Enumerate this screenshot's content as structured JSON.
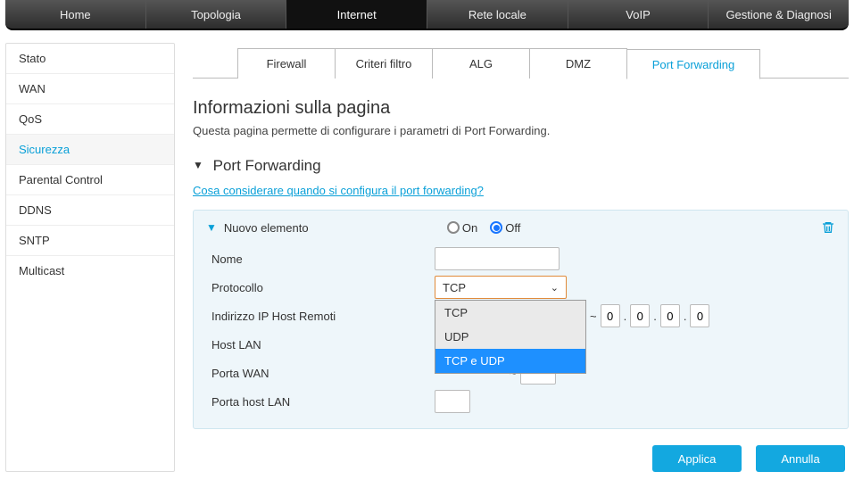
{
  "topnav": {
    "items": [
      "Home",
      "Topologia",
      "Internet",
      "Rete locale",
      "VoIP",
      "Gestione & Diagnosi"
    ],
    "active": 2
  },
  "sidebar": {
    "items": [
      "Stato",
      "WAN",
      "QoS",
      "Sicurezza",
      "Parental Control",
      "DDNS",
      "SNTP",
      "Multicast"
    ],
    "active": 3
  },
  "subtabs": {
    "items": [
      "Firewall",
      "Criteri filtro",
      "ALG",
      "DMZ",
      "Port Forwarding"
    ],
    "active": 4
  },
  "page_title": "Informazioni sulla pagina",
  "page_desc": "Questa pagina permette di configurare i parametri di Port Forwarding.",
  "section_title": "Port Forwarding",
  "help_link": "Cosa considerare quando si configura il port forwarding?",
  "panel": {
    "new_label": "Nuovo elemento",
    "radio": {
      "on": "On",
      "off": "Off",
      "checked": "off"
    },
    "fields": {
      "nome": {
        "label": "Nome",
        "value": ""
      },
      "protocollo": {
        "label": "Protocollo",
        "selected": "TCP",
        "options": [
          "TCP",
          "UDP",
          "TCP e UDP"
        ],
        "highlighted": 2
      },
      "ip_remoti": {
        "label": "Indirizzo IP Host Remoti",
        "oct2": [
          "0",
          "0",
          "0",
          "0"
        ]
      },
      "host_lan": {
        "label": "Host LAN"
      },
      "porta_wan": {
        "label": "Porta WAN"
      },
      "porta_host_lan": {
        "label": "Porta host LAN"
      }
    }
  },
  "buttons": {
    "apply": "Applica",
    "cancel": "Annulla"
  }
}
